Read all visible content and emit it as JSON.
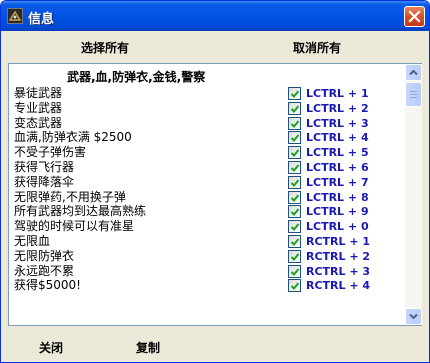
{
  "window": {
    "title": "信息",
    "colors": {
      "titlebar": "#0052e3",
      "key_text": "#1a1ab2",
      "check": "#21a121",
      "body": "#ece9d8"
    }
  },
  "toolbar": {
    "select_all": "选择所有",
    "cancel_all": "取消所有"
  },
  "list": {
    "section_title": "武器,血,防弹衣,金钱,警察",
    "items": [
      {
        "label": "暴徒武器",
        "checked": true,
        "key": "LCTRL + 1"
      },
      {
        "label": "专业武器",
        "checked": true,
        "key": "LCTRL + 2"
      },
      {
        "label": "变态武器",
        "checked": true,
        "key": "LCTRL + 3"
      },
      {
        "label": "血满,防弹衣满 $2500",
        "checked": true,
        "key": "LCTRL + 4"
      },
      {
        "label": "不受子弹伤害",
        "checked": true,
        "key": "LCTRL + 5"
      },
      {
        "label": "获得飞行器",
        "checked": true,
        "key": "LCTRL + 6"
      },
      {
        "label": "获得降落伞",
        "checked": true,
        "key": "LCTRL + 7"
      },
      {
        "label": "无限弹药,不用换子弹",
        "checked": true,
        "key": "LCTRL + 8"
      },
      {
        "label": "所有武器均到达最高熟练",
        "checked": true,
        "key": "LCTRL + 9"
      },
      {
        "label": "驾驶的时候可以有准星",
        "checked": true,
        "key": "LCTRL + 0"
      },
      {
        "label": "无限血",
        "checked": true,
        "key": "RCTRL + 1"
      },
      {
        "label": "无限防弹衣",
        "checked": true,
        "key": "RCTRL + 2"
      },
      {
        "label": "永远跑不累",
        "checked": true,
        "key": "RCTRL + 3"
      },
      {
        "label": "获得$5000!",
        "checked": true,
        "key": "RCTRL + 4"
      }
    ]
  },
  "footer": {
    "close_label": "关闭",
    "copy_label": "复制"
  }
}
